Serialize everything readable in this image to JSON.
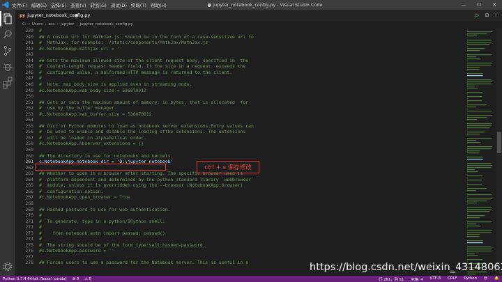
{
  "window": {
    "menus": [
      "文件(F)",
      "编辑(E)",
      "选择(S)",
      "查看(V)",
      "转到(G)",
      "调试(D)",
      "终端(T)",
      "帮助(H)"
    ],
    "title": "● jupyter_notebook_config.py - Visual Studio Code",
    "controls": {
      "minimize": "—",
      "maximize": "☐",
      "close": "✕"
    }
  },
  "activity_bar": {
    "icons": [
      "explorer-icon",
      "search-icon",
      "source-control-icon",
      "debug-icon",
      "extensions-icon"
    ],
    "bottom_icon": "settings-gear-icon"
  },
  "tab": {
    "file_icon": "py",
    "label": "jupyter_notebook_config.py",
    "dirty": true
  },
  "editor_actions": [
    "▷",
    "⊟",
    "···"
  ],
  "breadcrumb": [
    "C:",
    "Users",
    "ass",
    "jupyter",
    "jupyter_notebook_config.py"
  ],
  "code_lines": [
    {
      "n": "239",
      "text": "#",
      "type": "comment"
    },
    {
      "n": "240",
      "text": "## A custom url for MathJax.js. Should be in the form of a case-sensitive url to",
      "type": "comment"
    },
    {
      "n": "241",
      "text": "#  MathJax, for example:  /static/components/MathJax/MathJax.js",
      "type": "comment"
    },
    {
      "n": "242",
      "text": "#c.NotebookApp.mathjax_url = ''",
      "type": "comment"
    },
    {
      "n": "243",
      "text": "",
      "type": "comment"
    },
    {
      "n": "244",
      "text": "## Sets the maximum allowed size of the client request body, specified in  the",
      "type": "comment"
    },
    {
      "n": "245",
      "text": "#  Content-Length request header field. If the size in a request  exceeds the",
      "type": "comment"
    },
    {
      "n": "246",
      "text": "#  configured value, a malformed HTTP message is returned to the client.",
      "type": "comment"
    },
    {
      "n": "247",
      "text": "#",
      "type": "comment"
    },
    {
      "n": "248",
      "text": "#  Note: max_body_size is applied even in streaming mode.",
      "type": "comment"
    },
    {
      "n": "249",
      "text": "#c.NotebookApp.max_body_size = 536870912",
      "type": "comment"
    },
    {
      "n": "250",
      "text": "",
      "type": "comment"
    },
    {
      "n": "251",
      "text": "## Gets or sets the maximum amount of memory, in bytes, that is allocated  for",
      "type": "comment"
    },
    {
      "n": "252",
      "text": "#  use by the buffer manager.",
      "type": "comment"
    },
    {
      "n": "253",
      "text": "#c.NotebookApp.max_buffer_size = 536870912",
      "type": "comment"
    },
    {
      "n": "254",
      "text": "",
      "type": "comment"
    },
    {
      "n": "255",
      "text": "## Dict of Python modules to load as notebook server extensions.Entry values can",
      "type": "comment"
    },
    {
      "n": "256",
      "text": "#  be used to enable and disable the loading ofthe extensions. The extensions",
      "type": "comment"
    },
    {
      "n": "257",
      "text": "#  will be loaded in alphabetical order.",
      "type": "comment"
    },
    {
      "n": "258",
      "text": "#c.NotebookApp.nbserver_extensions = {}",
      "type": "comment"
    },
    {
      "n": "259",
      "text": "",
      "type": "comment"
    },
    {
      "n": "260",
      "text": "## The directory to use for notebooks and kernels.",
      "type": "comment"
    },
    {
      "n": "261",
      "text": "c.NotebookApp.notebook_dir = 'D:\\jupyter_notebook'",
      "type": "code"
    },
    {
      "n": "262",
      "text": "",
      "type": "comment"
    },
    {
      "n": "263",
      "text": "## Whether to open in a browser after starting. The specific browser used is",
      "type": "comment"
    },
    {
      "n": "264",
      "text": "#  platform dependent and determined by the python standard library `webbrowser`",
      "type": "comment"
    },
    {
      "n": "265",
      "text": "#  module, unless it is overridden using the --browser (NotebookApp.browser)",
      "type": "comment"
    },
    {
      "n": "266",
      "text": "#  configuration option.",
      "type": "comment"
    },
    {
      "n": "267",
      "text": "#c.NotebookApp.open_browser = True",
      "type": "comment"
    },
    {
      "n": "268",
      "text": "",
      "type": "comment"
    },
    {
      "n": "269",
      "text": "## Hashed password to use for web authentication.",
      "type": "comment"
    },
    {
      "n": "270",
      "text": "#",
      "type": "comment"
    },
    {
      "n": "271",
      "text": "#  To generate, type in a python/IPython shell:",
      "type": "comment"
    },
    {
      "n": "272",
      "text": "#",
      "type": "comment"
    },
    {
      "n": "273",
      "text": "#    from notebook.auth import passwd; passwd()",
      "type": "comment"
    },
    {
      "n": "274",
      "text": "#",
      "type": "comment"
    },
    {
      "n": "275",
      "text": "#  The string should be of the form type:salt:hashed-password.",
      "type": "comment"
    },
    {
      "n": "276",
      "text": "#c.NotebookApp.password = ''",
      "type": "comment"
    },
    {
      "n": "277",
      "text": "",
      "type": "comment"
    },
    {
      "n": "278",
      "text": "## Forces users to use a password for the Notebook server. This is useful in a",
      "type": "comment"
    }
  ],
  "annotation": "ctrl + s 保存修改",
  "watermark": "https://blog.csdn.net/weixin_43148062",
  "status_bar": {
    "interpreter": "Python 3.7.4 64-bit ('base': conda)",
    "errors": "⊗ 0",
    "warnings": "⚠ 0",
    "cursor": "行 261，列 51",
    "spaces": "空格: 4",
    "encoding": "UTF-8",
    "eol": "CRLF",
    "language": "Python",
    "feedback": "☺",
    "bell": "🔔"
  },
  "colors": {
    "titlebar": "#3c3c3c",
    "activity_bar": "#333333",
    "editor_bg": "#1e1e1e",
    "comment": "#6a9955",
    "status_bar": "#68217a",
    "highlight": "#e53935"
  }
}
